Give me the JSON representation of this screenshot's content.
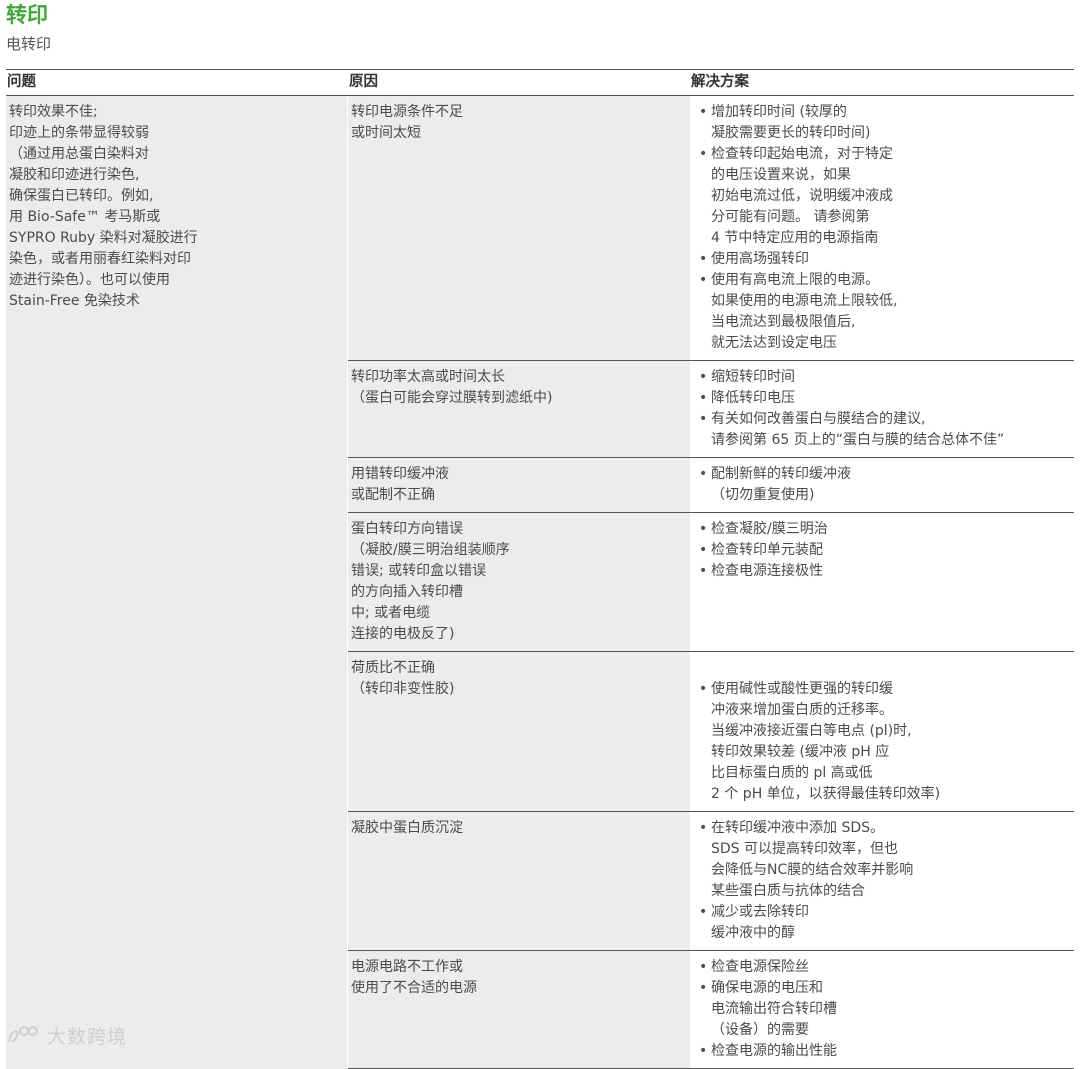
{
  "header": {
    "title": "转印",
    "subtitle": "电转印"
  },
  "table": {
    "columns": [
      "问题",
      "原因",
      "解决方案"
    ],
    "problem_lines": [
      "转印效果不佳;",
      "印迹上的条带显得较弱",
      "（通过用总蛋白染料对",
      "凝胶和印迹进行染色,",
      "确保蛋白已转印。例如,",
      "用 Bio-Safe™ 考马斯或",
      "SYPRO Ruby 染料对凝胶进行",
      "染色，或者用丽春红染料对印",
      "迹进行染色）。也可以使用",
      "Stain-Free 免染技术"
    ],
    "rows": [
      {
        "cause": [
          "转印电源条件不足",
          "或时间太短"
        ],
        "solutions": [
          [
            "增加转印时间 (较厚的",
            "凝胶需要更长的转印时间)"
          ],
          [
            "检查转印起始电流，对于特定",
            "的电压设置来说，如果",
            "初始电流过低，说明缓冲液成",
            "分可能有问题。 请参阅第",
            "4 节中特定应用的电源指南"
          ],
          [
            "使用高场强转印"
          ],
          [
            "使用有高电流上限的电源。",
            "如果使用的电源电流上限较低,",
            "当电流达到最极限值后,",
            "就无法达到设定电压"
          ]
        ]
      },
      {
        "cause": [
          "转印功率太高或时间太长",
          "（蛋白可能会穿过膜转到滤纸中)"
        ],
        "solutions": [
          [
            "缩短转印时间"
          ],
          [
            "降低转印电压"
          ],
          [
            "有关如何改善蛋白与膜结合的建议,",
            "请参阅第 65 页上的“蛋白与膜的结合总体不佳”"
          ]
        ]
      },
      {
        "cause": [
          "用错转印缓冲液",
          "或配制不正确"
        ],
        "solutions": [
          [
            "配制新鲜的转印缓冲液",
            "（切勿重复使用)"
          ]
        ]
      },
      {
        "cause": [
          "蛋白转印方向错误",
          "（凝胶/膜三明治组装顺序",
          "错误; 或转印盒以错误",
          "的方向插入转印槽",
          "中; 或者电缆",
          "连接的电极反了)"
        ],
        "solutions": [
          [
            "检查凝胶/膜三明治"
          ],
          [
            "检查转印单元装配"
          ],
          [
            "检查电源连接极性"
          ]
        ]
      },
      {
        "cause": [
          "荷质比不正确",
          "（转印非变性胶)"
        ],
        "solutions": [
          [
            "",
            "使用碱性或酸性更强的转印缓",
            "冲液来增加蛋白质的迁移率。",
            "当缓冲液接近蛋白等电点 (pl)时,",
            "转印效果较差 (缓冲液 pH 应",
            "比目标蛋白质的 pl 高或低",
            "2 个 pH 单位，以获得最佳转印效率)"
          ]
        ]
      },
      {
        "cause": [
          "凝胶中蛋白质沉淀"
        ],
        "solutions": [
          [
            "在转印缓冲液中添加 SDS。",
            "SDS 可以提高转印效率，但也",
            "会降低与NC膜的结合效率并影响",
            "某些蛋白质与抗体的结合"
          ],
          [
            "减少或去除转印",
            "缓冲液中的醇"
          ]
        ]
      },
      {
        "cause": [
          "电源电路不工作或",
          "使用了不合适的电源"
        ],
        "solutions": [
          [
            "检查电源保险丝"
          ],
          [
            "确保电源的电压和",
            "电流输出符合转印槽",
            "（设备）的需要"
          ],
          [
            "检查电源的输出性能"
          ]
        ]
      }
    ]
  },
  "watermark": {
    "text": "大数跨境"
  }
}
